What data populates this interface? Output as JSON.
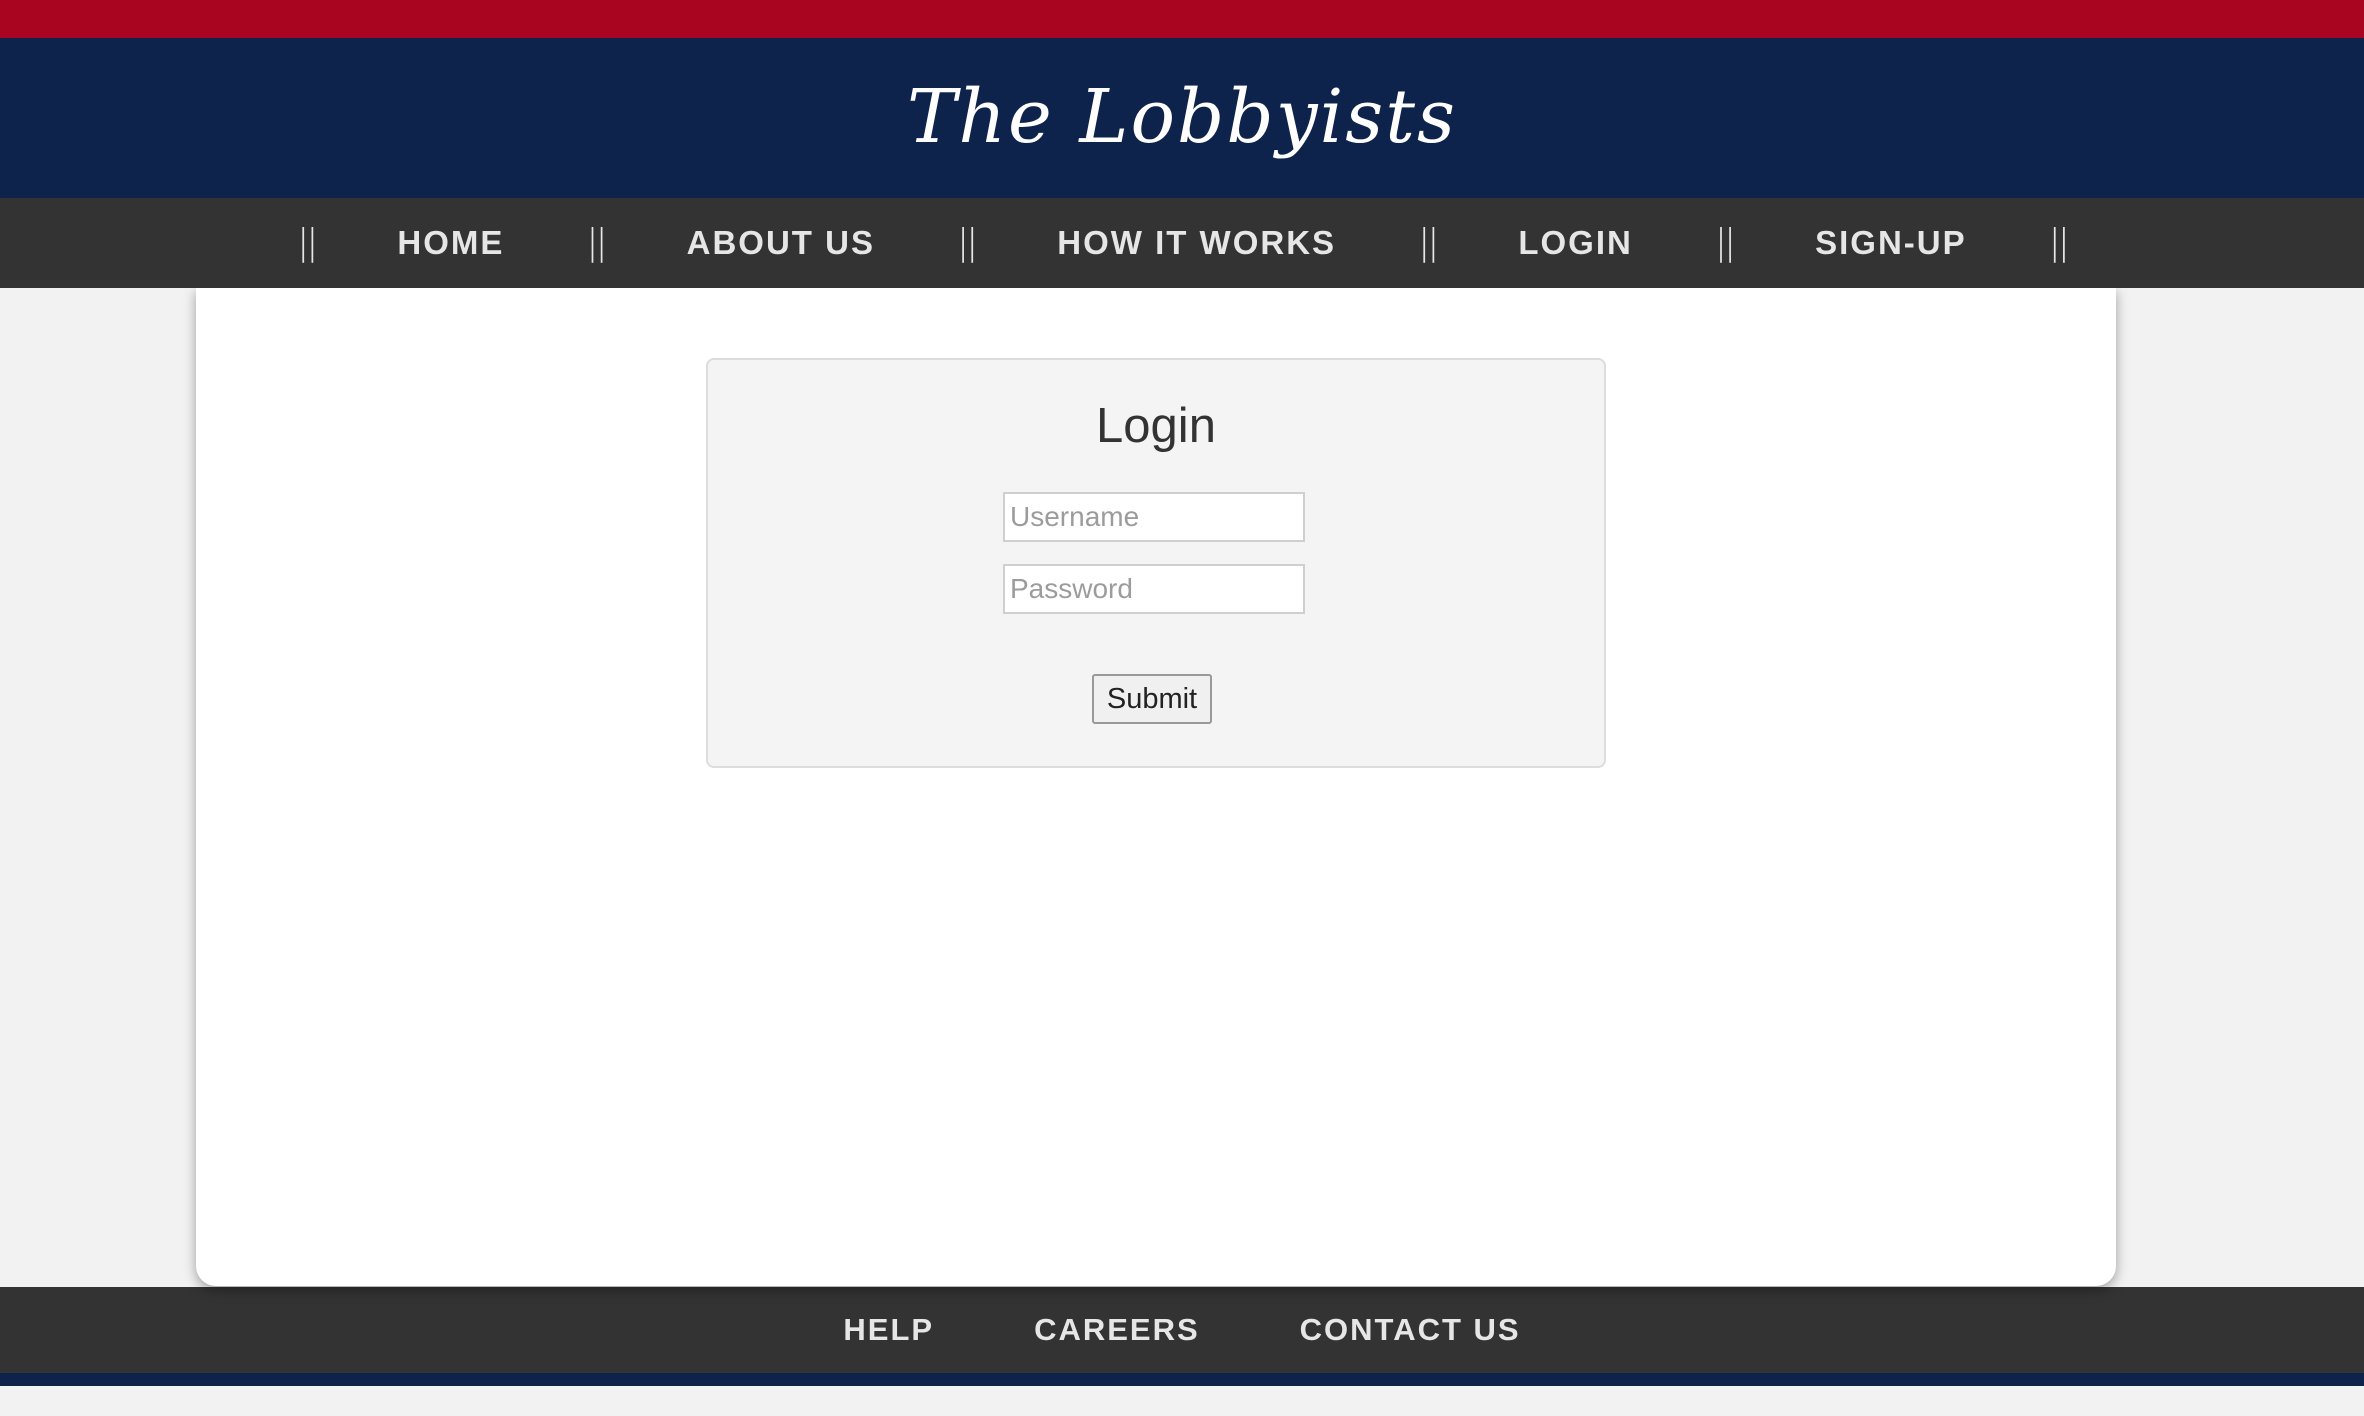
{
  "site": {
    "title": "The Lobbyists"
  },
  "nav": {
    "separator": "||",
    "items": [
      {
        "label": "HOME"
      },
      {
        "label": "ABOUT US"
      },
      {
        "label": "HOW IT WORKS"
      },
      {
        "label": "LOGIN"
      },
      {
        "label": "SIGN-UP"
      }
    ]
  },
  "login": {
    "title": "Login",
    "username_placeholder": "Username",
    "password_placeholder": "Password",
    "submit_label": "Submit"
  },
  "footer": {
    "items": [
      {
        "label": "HELP"
      },
      {
        "label": "CAREERS"
      },
      {
        "label": "CONTACT US"
      }
    ]
  },
  "colors": {
    "accent_red": "#a90520",
    "navy": "#0d234b",
    "nav_dark": "#333333",
    "page_bg": "#f2f2f2"
  }
}
